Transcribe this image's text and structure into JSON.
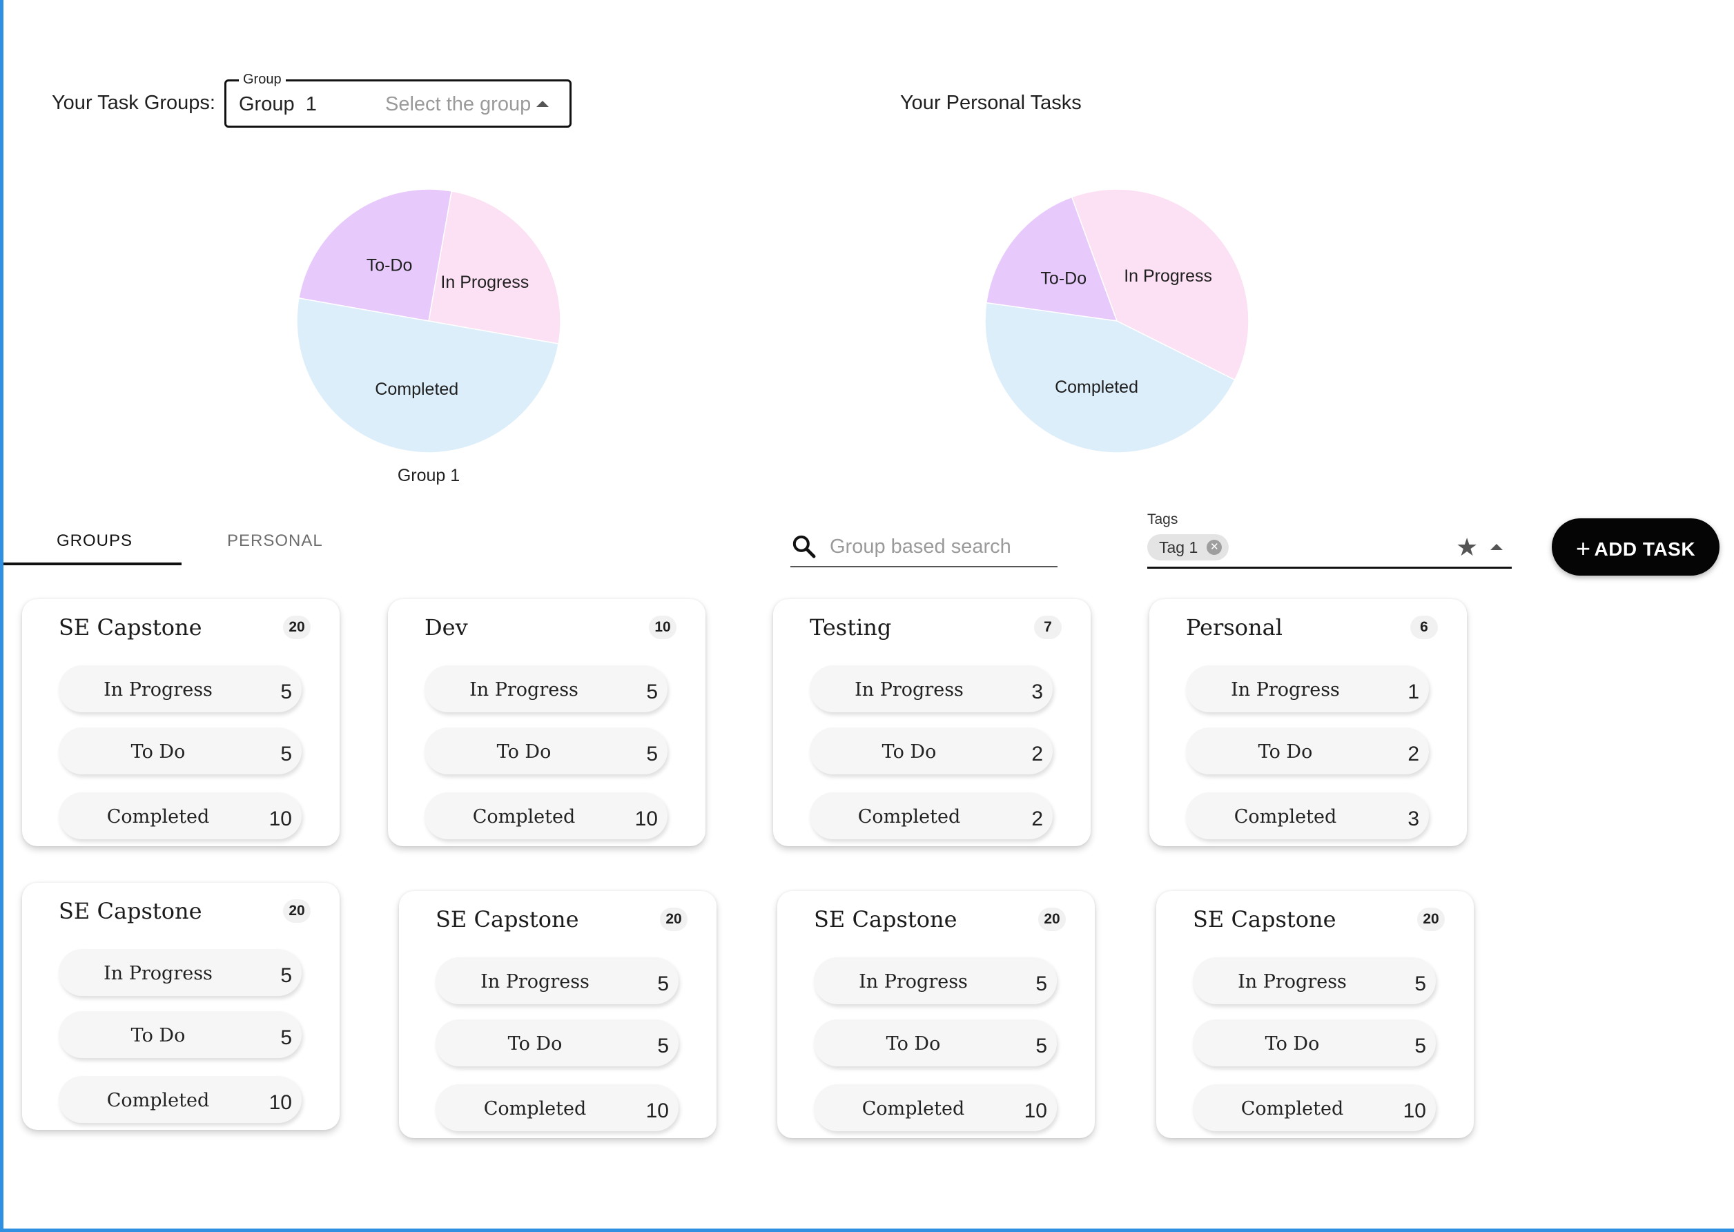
{
  "header": {
    "groups_label": "Your Task Groups:",
    "group_select": {
      "legend": "Group",
      "value": "Group  1",
      "placeholder": "Select the group"
    },
    "personal_title": "Your Personal Tasks"
  },
  "charts": {
    "group_pie": {
      "type": "pie",
      "caption": "Group 1",
      "slices": [
        {
          "label": "In Progress",
          "value": 5,
          "color": "#fce0f3"
        },
        {
          "label": "Completed",
          "value": 10,
          "color": "#ddeefb"
        },
        {
          "label": "To-Do",
          "value": 5,
          "color": "#e7cafb"
        }
      ]
    },
    "personal_pie": {
      "type": "pie",
      "slices": [
        {
          "label": "In Progress",
          "value": 11,
          "color": "#fce0f3"
        },
        {
          "label": "Completed",
          "value": 13,
          "color": "#ddeefb"
        },
        {
          "label": "To-Do",
          "value": 5,
          "color": "#e7cafb"
        }
      ]
    }
  },
  "tabs": {
    "groups": "GROUPS",
    "personal": "PERSONAL",
    "active": "groups"
  },
  "search": {
    "placeholder": "Group based search",
    "icon": "search-icon"
  },
  "tags": {
    "label": "Tags",
    "chip": "Tag 1",
    "star_icon": "star-icon"
  },
  "add_task": {
    "label": "ADD TASK",
    "icon": "plus-icon"
  },
  "cards": [
    {
      "title": "SE Capstone",
      "count": "20",
      "in_progress_label": "In Progress",
      "in_progress": "5",
      "todo_label": "To Do",
      "todo": "5",
      "completed_label": "Completed",
      "completed": "10"
    },
    {
      "title": "Dev",
      "count": "10",
      "in_progress_label": "In Progress",
      "in_progress": "5",
      "todo_label": "To Do",
      "todo": "5",
      "completed_label": "Completed",
      "completed": "10"
    },
    {
      "title": "Testing",
      "count": "7",
      "in_progress_label": "In Progress",
      "in_progress": "3",
      "todo_label": "To Do",
      "todo": "2",
      "completed_label": "Completed",
      "completed": "2"
    },
    {
      "title": "Personal",
      "count": "6",
      "in_progress_label": "In Progress",
      "in_progress": "1",
      "todo_label": "To Do",
      "todo": "2",
      "completed_label": "Completed",
      "completed": "3"
    },
    {
      "title": "SE Capstone",
      "count": "20",
      "in_progress_label": "In Progress",
      "in_progress": "5",
      "todo_label": "To Do",
      "todo": "5",
      "completed_label": "Completed",
      "completed": "10"
    },
    {
      "title": "SE Capstone",
      "count": "20",
      "in_progress_label": "In Progress",
      "in_progress": "5",
      "todo_label": "To Do",
      "todo": "5",
      "completed_label": "Completed",
      "completed": "10"
    },
    {
      "title": "SE Capstone",
      "count": "20",
      "in_progress_label": "In Progress",
      "in_progress": "5",
      "todo_label": "To Do",
      "todo": "5",
      "completed_label": "Completed",
      "completed": "10"
    },
    {
      "title": "SE Capstone",
      "count": "20",
      "in_progress_label": "In Progress",
      "in_progress": "5",
      "todo_label": "To Do",
      "todo": "5",
      "completed_label": "Completed",
      "completed": "10"
    }
  ]
}
